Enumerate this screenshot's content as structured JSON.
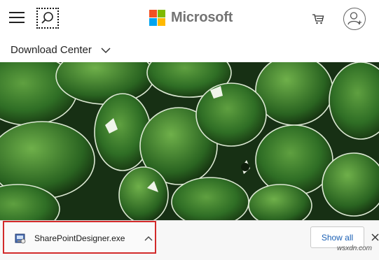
{
  "header": {
    "logo_text": "Microsoft",
    "logo_colors": [
      "#f25022",
      "#7fba00",
      "#00a4ef",
      "#ffb900"
    ],
    "icons": [
      "hamburger-icon",
      "search-icon",
      "cart-icon",
      "avatar-icon"
    ]
  },
  "subnav": {
    "title": "Download Center",
    "chevron_icon": "chevron-down-icon"
  },
  "download_bar": {
    "file_name": "SharePointDesigner.exe",
    "file_icon": "installer-icon",
    "expand_icon": "chevron-up-icon",
    "show_all_label": "Show all",
    "close_icon": "close-icon",
    "highlight_color": "#d22a2a"
  },
  "watermark": "wsxdn.com"
}
